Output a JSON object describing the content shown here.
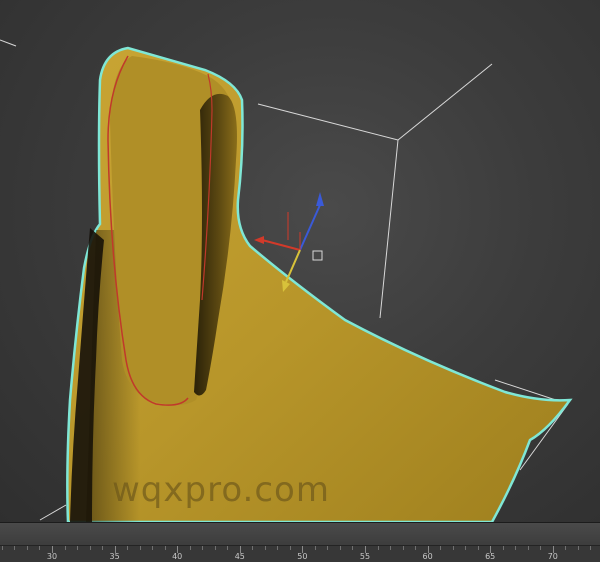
{
  "viewport": {
    "watermark_text": "wqxpro.com",
    "colors": {
      "background": "#3c3c3c",
      "mesh_fill": "#b8962a",
      "selection_outline": "#7fe7d6",
      "seam": "#c0392b",
      "bounding_box": "#d8d8d8",
      "gizmo_x": "#d23a2a",
      "gizmo_y": "#d8c23a",
      "gizmo_z": "#3a5ad8"
    },
    "icons": {
      "transform_gizmo": "move-gizmo-icon",
      "pivot": "pivot-icon"
    }
  },
  "timeline": {
    "labels": [
      "30",
      "35",
      "40",
      "45",
      "50",
      "55",
      "60",
      "65",
      "70"
    ]
  }
}
